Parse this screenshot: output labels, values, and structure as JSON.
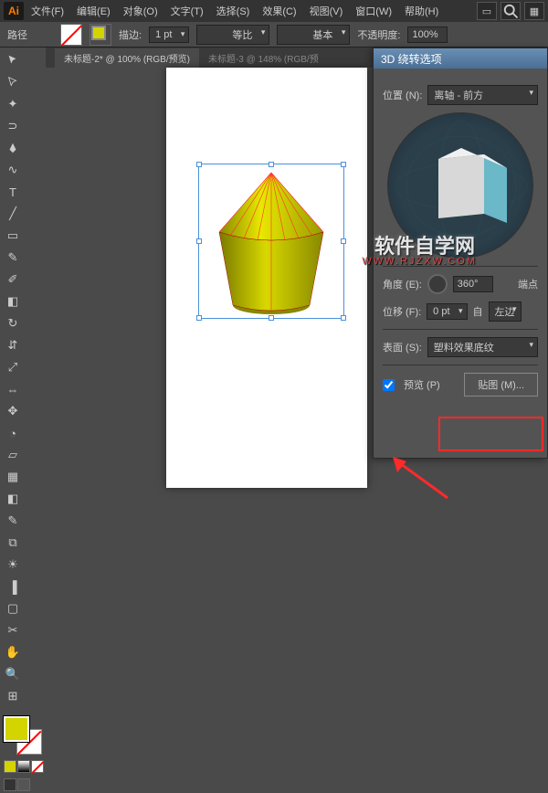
{
  "app": {
    "logo": "Ai"
  },
  "menu": {
    "file": "文件(F)",
    "edit": "编辑(E)",
    "object": "对象(O)",
    "text": "文字(T)",
    "select": "选择(S)",
    "effect": "效果(C)",
    "view": "视图(V)",
    "window": "窗口(W)",
    "help": "帮助(H)"
  },
  "control": {
    "path_label": "路径",
    "stroke_label": "描边:",
    "stroke_weight": "1 pt",
    "profile": "等比",
    "brush": "基本",
    "opacity_label": "不透明度:",
    "opacity_value": "100%"
  },
  "tabs": {
    "tab1": "未标题-2* @ 100% (RGB/预览)",
    "tab2": "未标题-3 @ 148% (RGB/预"
  },
  "panel": {
    "title": "3D 绕转选项",
    "position_label": "位置 (N):",
    "position_value": "离轴 - 前方",
    "angle_label": "角度 (E):",
    "angle_value": "360°",
    "cap_label": "端点",
    "offset_label": "位移 (F):",
    "offset_value": "0 pt",
    "from_label": "自",
    "edge_label": "左边",
    "surface_label": "表面 (S):",
    "surface_value": "塑料效果底纹",
    "preview_label": "预览 (P)",
    "map_button": "贴图 (M)..."
  },
  "watermark": {
    "main": "软件自学网",
    "sub": "WWW.RJZXW.COM"
  },
  "colors": {
    "fill": "#d4d400",
    "accent": "#ff7b00",
    "panel_header": "#5a80a8"
  }
}
